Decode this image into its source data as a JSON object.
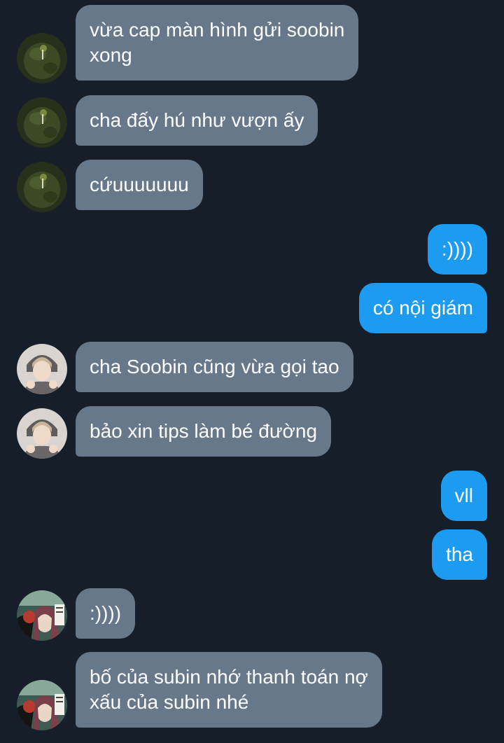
{
  "conversation": {
    "messages": [
      {
        "side": "incoming",
        "author": "friend-green",
        "text": "vừa cap màn hình gửi soobin\nxong"
      },
      {
        "side": "incoming",
        "author": "friend-green",
        "text": "cha đấy hú như vượn ấy"
      },
      {
        "side": "incoming",
        "author": "friend-green",
        "text": "cứuuuuuuu"
      },
      {
        "side": "outgoing",
        "text": ":))))"
      },
      {
        "side": "outgoing",
        "text": "có nội giám"
      },
      {
        "side": "incoming",
        "author": "friend-photo",
        "text": "cha Soobin cũng vừa gọi tao"
      },
      {
        "side": "incoming",
        "author": "friend-photo",
        "text": "bảo xin tips làm bé đường"
      },
      {
        "side": "outgoing",
        "text": "vll"
      },
      {
        "side": "outgoing",
        "text": "tha"
      },
      {
        "side": "incoming",
        "author": "friend-anime",
        "text": ":))))"
      },
      {
        "side": "incoming",
        "author": "friend-anime",
        "text": "bố của subin nhớ thanh toán nợ\nxấu của subin nhé"
      }
    ]
  },
  "colors": {
    "background": "#161e29",
    "incoming_bubble": "#66788a",
    "outgoing_bubble": "#1d9bf0",
    "text": "#ffffff"
  }
}
